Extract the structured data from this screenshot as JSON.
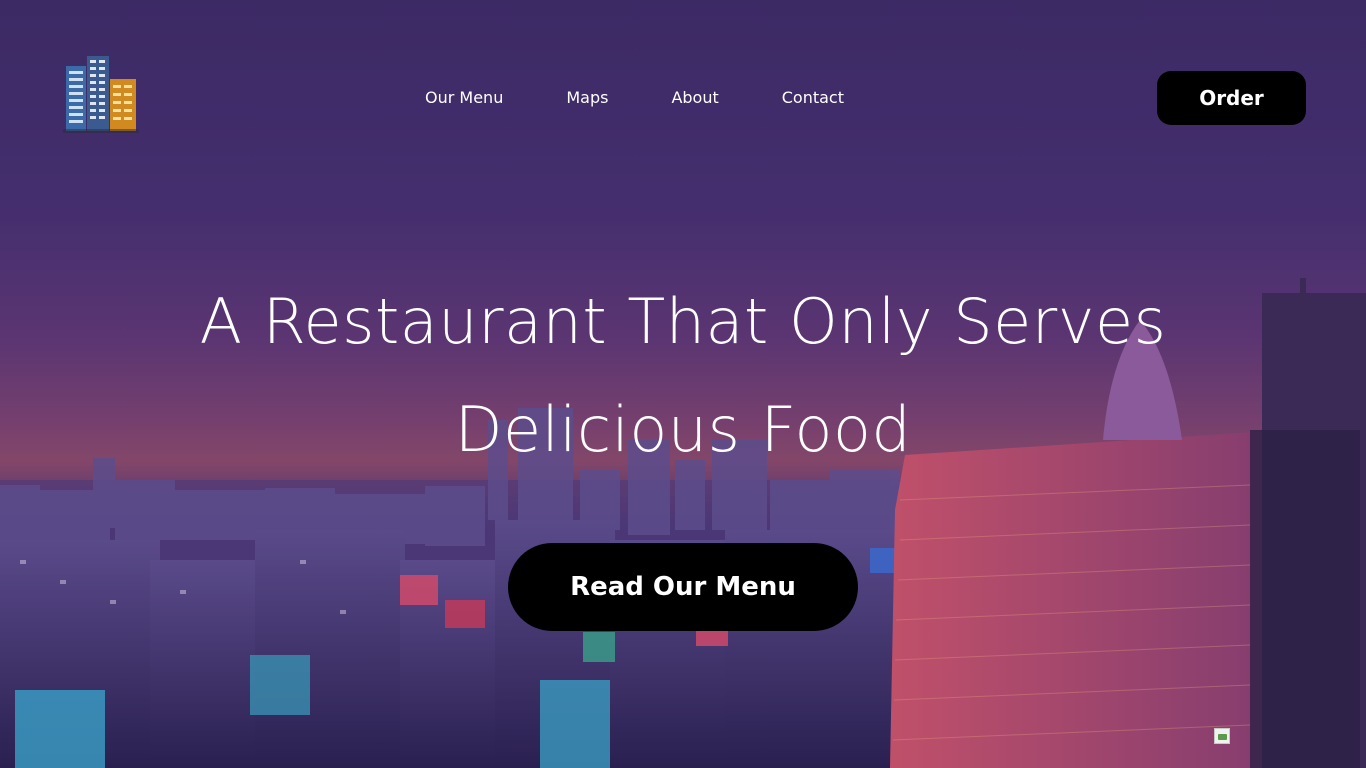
{
  "nav": {
    "logo_icon": "city-buildings-logo-icon",
    "links": [
      {
        "label": "Our Menu"
      },
      {
        "label": "Maps"
      },
      {
        "label": "About"
      },
      {
        "label": "Contact"
      }
    ],
    "order_label": "Order"
  },
  "hero": {
    "headline_line1": "A Restaurant That Only Serves",
    "headline_line2": "Delicious Food",
    "cta_label": "Read Our Menu",
    "background": "city-skyline-dusk-photo",
    "overlay_color": "#3c2b66"
  },
  "colors": {
    "button_bg": "#000000",
    "text": "#ffffff"
  },
  "footer_icon": "broken-image-icon"
}
